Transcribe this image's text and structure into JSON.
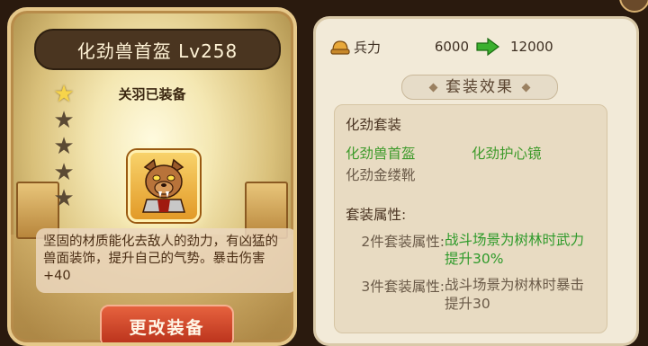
{
  "item": {
    "title": "化劲兽首盔  Lv258",
    "equipped_by": "关羽已装备",
    "stars_total": 5,
    "stars_filled": 1,
    "description": "坚固的材质能化去敌人的劲力，有凶猛的兽面装饰，提升自己的气势。暴击伤害+40",
    "change_button": "更改装备"
  },
  "stats": {
    "troops_label": "兵力",
    "troops_current": "6000",
    "troops_next": "12000"
  },
  "set_effect": {
    "header": "套装效果",
    "set_name": "化劲套装",
    "pieces": [
      {
        "name": "化劲兽首盔",
        "owned": true
      },
      {
        "name": "化劲护心镜",
        "owned": true
      },
      {
        "name": "化劲金缕靴",
        "owned": false
      }
    ],
    "attributes_title": "套装属性:",
    "bonuses": [
      {
        "label": "2件套装属性:",
        "text": "战斗场景为树林时武力提升30%",
        "active": true
      },
      {
        "label": "3件套装属性:",
        "text": "战斗场景为树林时暴击提升30",
        "active": false
      }
    ]
  },
  "colors": {
    "active_green": "#2e9a2a",
    "star_on": "#f7d44a",
    "button_red": "#c8401f"
  }
}
